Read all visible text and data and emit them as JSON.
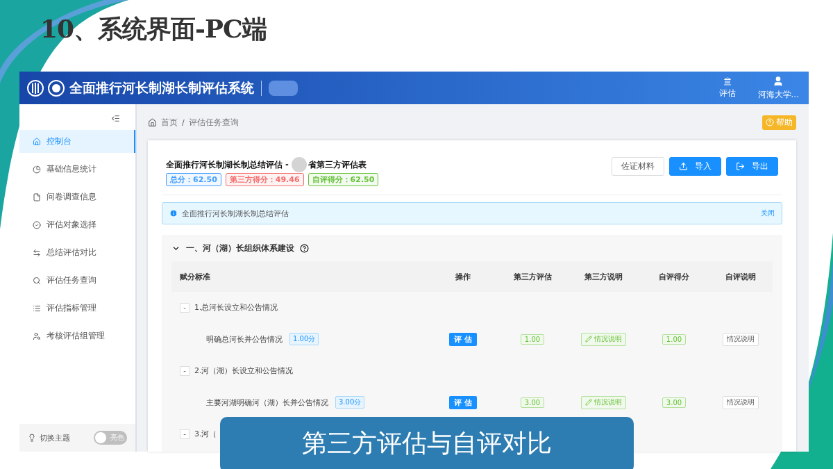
{
  "slide_title": "10、系统界面-PC端",
  "app": {
    "title": "全面推行河长制湖长制评估系统",
    "nav": [
      {
        "kind": "assess",
        "label": "评估"
      },
      {
        "kind": "user",
        "label": "河海大学..."
      }
    ],
    "sidebar": {
      "items": [
        {
          "label": "控制台",
          "selected": true
        },
        {
          "label": "基础信息统计",
          "selected": false
        },
        {
          "label": "问卷调查信息",
          "selected": false
        },
        {
          "label": "评估对象选择",
          "selected": false
        },
        {
          "label": "总结评估对比",
          "selected": false
        },
        {
          "label": "评估任务查询",
          "selected": false
        },
        {
          "label": "评估指标管理",
          "selected": false
        },
        {
          "label": "考核评估组管理",
          "selected": false
        }
      ],
      "theme": {
        "label": "切换主题",
        "switch_label": "亮色",
        "on": false
      }
    },
    "breadcrumb": [
      "首页",
      "评估任务查询"
    ],
    "breadcrumb_separator": "/",
    "help": "帮助",
    "card": {
      "title_start": "全面推行河长制湖长制总结评估 -",
      "title_end": "省第三方评估表",
      "scores": [
        {
          "text": "总分：62.50",
          "color": "#409eff"
        },
        {
          "text": "第三方得分：49.46",
          "color": "#f56c6c"
        },
        {
          "text": "自评得分：62.50",
          "color": "#67c23a"
        }
      ],
      "buttons": [
        {
          "kind": "plain",
          "label": "佐证材料"
        },
        {
          "kind": "import",
          "label": "导入"
        },
        {
          "kind": "export",
          "label": "导出"
        }
      ],
      "alert": {
        "text": "全面推行河长制湖长制总结评估",
        "close": "关闭"
      },
      "section": {
        "title": "一、河（湖）长组织体系建设",
        "expanded": true,
        "columns": [
          "赋分标准",
          "操作",
          "第三方评估",
          "第三方说明",
          "自评得分",
          "自评说明"
        ],
        "toggle_symbol": "-",
        "groups": [
          {
            "title": "1.总河长设立和公告情况",
            "expanded": true,
            "items": [
              {
                "name": "明确总河长并公告情况",
                "points": "1.00分",
                "action": "评 估",
                "third_score": "1.00",
                "third_note": "情况说明",
                "self_score": "1.00",
                "self_note": "情况说明"
              }
            ]
          },
          {
            "title": "2.河（湖）长设立和公告情况",
            "expanded": true,
            "items": [
              {
                "name": "主要河湖明确河（湖）长并公告情况",
                "points": "3.00分",
                "action": "评 估",
                "third_score": "3.00",
                "third_note": "情况说明",
                "self_score": "3.00",
                "self_note": "情况说明"
              }
            ]
          },
          {
            "title": "3.河（",
            "expanded": true
          }
        ]
      }
    }
  },
  "caption": "第三方评估与自评对比"
}
